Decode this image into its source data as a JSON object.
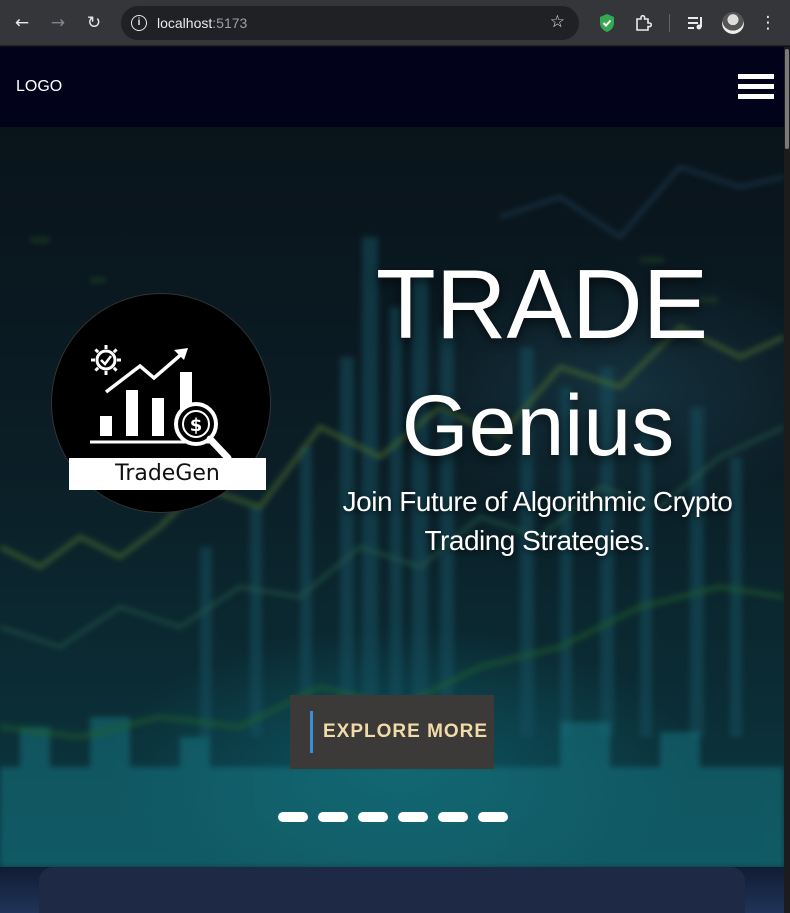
{
  "browser": {
    "back_icon": "arrow-left-icon",
    "forward_icon": "arrow-right-icon",
    "reload_icon": "reload-icon",
    "url_host": "localhost",
    "url_port": ":5173",
    "bookmark_icon": "star-icon"
  },
  "nav": {
    "logo": "LOGO",
    "menu_icon": "hamburger-icon"
  },
  "hero": {
    "brand_label": "TradeGen",
    "title_line1": "TRADE",
    "title_line2": "Genius",
    "subtitle": "Join Future of Algorithmic Crypto Trading Strategies.",
    "cta": "EXPLORE MORE",
    "slide_count": 6
  },
  "colors": {
    "nav_bg": "#02021a",
    "cta_bg": "#3b3a38",
    "cta_text": "#f1dba9",
    "cta_accent": "#3b8ed8"
  }
}
